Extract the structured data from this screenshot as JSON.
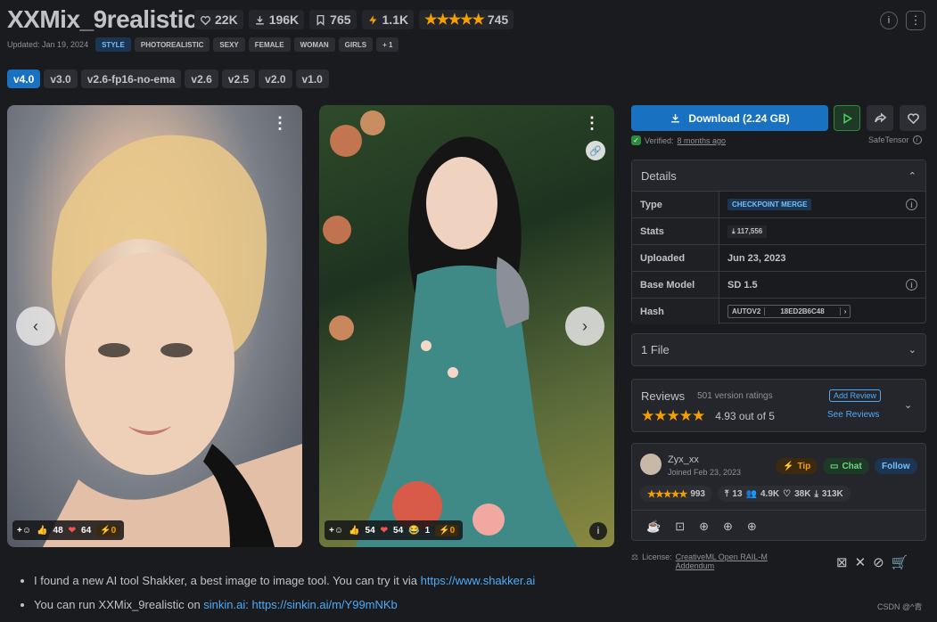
{
  "header": {
    "title": "XXMix_9realistic",
    "stats": {
      "likes": "22K",
      "downloads": "196K",
      "bookmarks": "765",
      "buzz": "1.1K",
      "rating_count": "745"
    },
    "updated": "Updated: Jan 19, 2024",
    "tags": [
      "STYLE",
      "PHOTOREALISTIC",
      "SEXY",
      "FEMALE",
      "WOMAN",
      "GIRLS",
      "+ 1"
    ]
  },
  "versions": [
    "v4.0",
    "v3.0",
    "v2.6-fp16-no-ema",
    "v2.6",
    "v2.5",
    "v2.0",
    "v1.0"
  ],
  "gallery": {
    "card1": {
      "thumbs_up": "48",
      "hearts": "64",
      "buzz": "0"
    },
    "card2": {
      "thumbs_up": "54",
      "hearts": "54",
      "laugh": "1",
      "buzz": "0"
    }
  },
  "download": {
    "label": "Download (2.24 GB)",
    "verified_prefix": "Verified: ",
    "verified_time": "8 months ago",
    "safetensor": "SafeTensor"
  },
  "details": {
    "title": "Details",
    "rows": {
      "type_label": "Type",
      "type_value": "CHECKPOINT MERGE",
      "stats_label": "Stats",
      "stats_value": "117,556",
      "uploaded_label": "Uploaded",
      "uploaded_value": "Jun 23, 2023",
      "base_label": "Base Model",
      "base_value": "SD 1.5",
      "hash_label": "Hash",
      "hash_type": "AUTOV2",
      "hash_value": "18ED2B6C48"
    }
  },
  "files": {
    "label": "1 File"
  },
  "reviews": {
    "title": "Reviews",
    "count": "501 version ratings",
    "score": "4.93 out of 5",
    "add_label": "Add Review",
    "see_label": "See Reviews"
  },
  "creator": {
    "name": "Zyx_xx",
    "joined": "Joined Feb 23, 2023",
    "tip": "Tip",
    "chat": "Chat",
    "follow": "Follow",
    "rating": "993",
    "uploads": "13",
    "followers": "4.9K",
    "likes": "38K",
    "downloads": "313K"
  },
  "license": {
    "prefix": "License: ",
    "name_line1": "CreativeML Open RAIL-M",
    "name_line2": "Addendum"
  },
  "description": {
    "line1_text": "I found a new AI tool Shakker, a best image to image tool. You can try it via ",
    "line1_link": "https://www.shakker.ai",
    "line2_text": "You can run XXMix_9realistic on ",
    "line2_link1": "sinkin.ai",
    "line2_sep": ": ",
    "line2_link2": "https://sinkin.ai/m/Y99mNKb"
  },
  "watermark": "CSDN @^青",
  "colors": {
    "accent": "#1971c2",
    "star": "#f59f00",
    "bg": "#1a1b1e"
  }
}
